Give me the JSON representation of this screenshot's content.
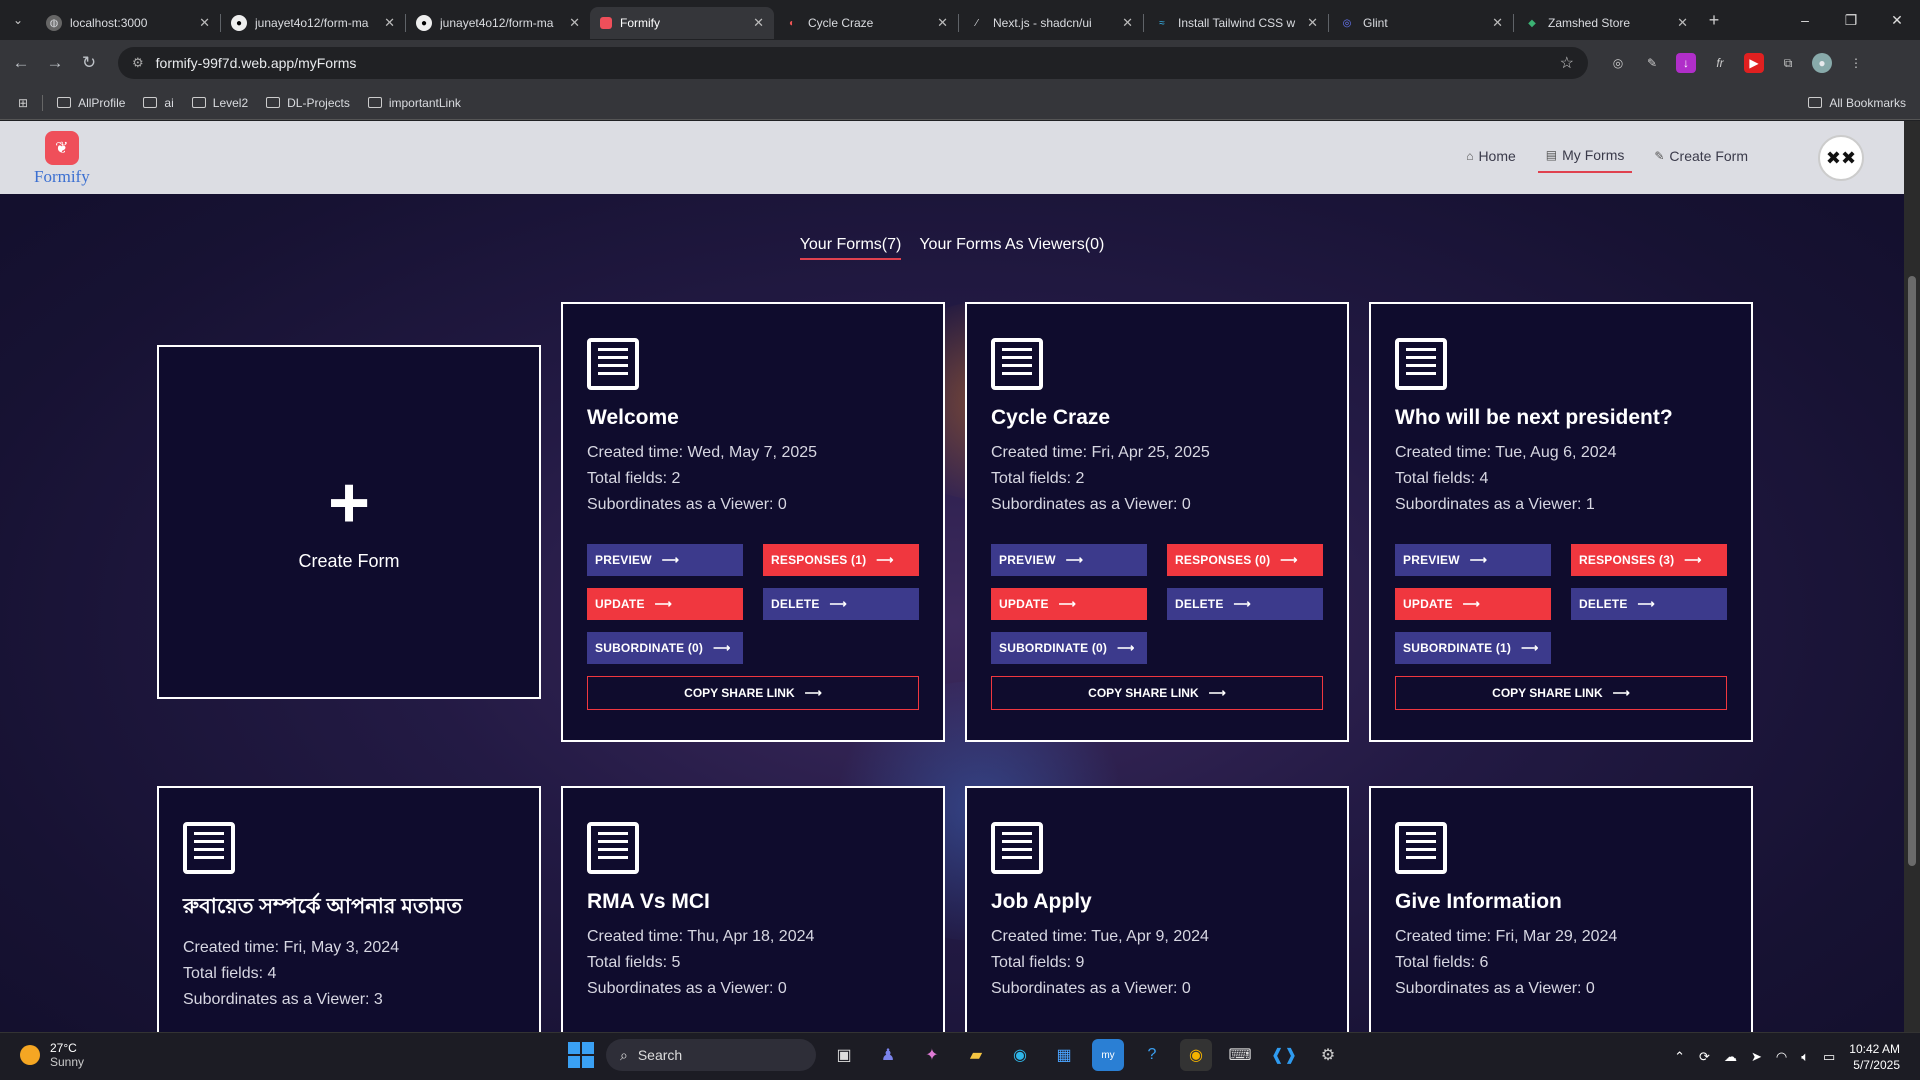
{
  "browser": {
    "tabs": [
      {
        "label": "localhost:3000",
        "icon": "globe-icon",
        "active": false
      },
      {
        "label": "junayet4o12/form-ma",
        "icon": "github-icon",
        "active": false
      },
      {
        "label": "junayet4o12/form-ma",
        "icon": "github-icon",
        "active": false
      },
      {
        "label": "Formify",
        "icon": "formify-icon",
        "active": true
      },
      {
        "label": "Cycle Craze",
        "icon": "cycle-icon",
        "active": false
      },
      {
        "label": "Next.js - shadcn/ui",
        "icon": "shadcn-icon",
        "active": false
      },
      {
        "label": "Install Tailwind CSS w",
        "icon": "tailwind-icon",
        "active": false
      },
      {
        "label": "Glint",
        "icon": "glint-icon",
        "active": false
      },
      {
        "label": "Zamshed Store",
        "icon": "store-icon",
        "active": false
      }
    ],
    "url": "formify-99f7d.web.app/myForms",
    "bookmarks": [
      "AllProfile",
      "ai",
      "Level2",
      "DL-Projects",
      "importantLink"
    ],
    "all_bookmarks": "All Bookmarks"
  },
  "app": {
    "logo_text": "Formify",
    "nav": {
      "home": "Home",
      "my_forms": "My Forms",
      "create_form": "Create Form"
    },
    "tabs": {
      "your_forms": "Your Forms(7)",
      "as_viewers": "Your Forms As Viewers(0)"
    },
    "create_card_label": "Create Form",
    "labels": {
      "preview": "PREVIEW",
      "update": "UPDATE",
      "delete": "DELETE",
      "copy": "COPY SHARE LINK"
    },
    "forms": [
      {
        "title": "Welcome",
        "created": "Created time: Wed, May 7, 2025",
        "fields": "Total fields: 2",
        "subs": "Subordinates as a Viewer: 0",
        "responses": "RESPONSES (1)",
        "subordinate": "SUBORDINATE (0)"
      },
      {
        "title": "Cycle Craze",
        "created": "Created time: Fri, Apr 25, 2025",
        "fields": "Total fields: 2",
        "subs": "Subordinates as a Viewer: 0",
        "responses": "RESPONSES (0)",
        "subordinate": "SUBORDINATE (0)"
      },
      {
        "title": "Who will be next president?",
        "created": "Created time: Tue, Aug 6, 2024",
        "fields": "Total fields: 4",
        "subs": "Subordinates as a Viewer: 1",
        "responses": "RESPONSES (3)",
        "subordinate": "SUBORDINATE (1)"
      },
      {
        "title": "রুবায়েত সম্পর্কে আপনার মতামত",
        "created": "Created time: Fri, May 3, 2024",
        "fields": "Total fields: 4",
        "subs": "Subordinates as a Viewer: 3"
      },
      {
        "title": "RMA Vs MCI",
        "created": "Created time: Thu, Apr 18, 2024",
        "fields": "Total fields: 5",
        "subs": "Subordinates as a Viewer: 0"
      },
      {
        "title": "Job Apply",
        "created": "Created time: Tue, Apr 9, 2024",
        "fields": "Total fields: 9",
        "subs": "Subordinates as a Viewer: 0"
      },
      {
        "title": "Give Information",
        "created": "Created time: Fri, Mar 29, 2024",
        "fields": "Total fields: 6",
        "subs": "Subordinates as a Viewer: 0"
      }
    ]
  },
  "taskbar": {
    "weather_temp": "27°C",
    "weather_desc": "Sunny",
    "search_placeholder": "Search",
    "time": "10:42 AM",
    "date": "5/7/2025"
  },
  "colors": {
    "accent_red": "#f0373f",
    "button_blue": "#3c3a8c",
    "card_bg": "#0f0c2d"
  }
}
